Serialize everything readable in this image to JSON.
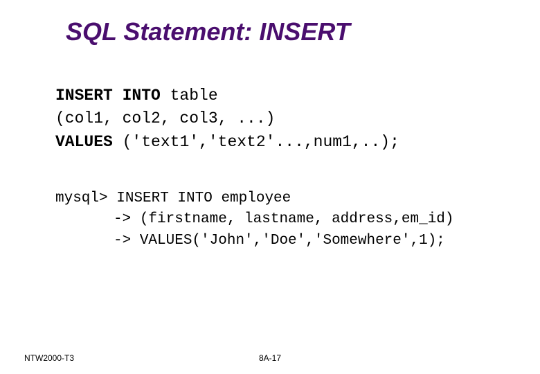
{
  "title": "SQL Statement: INSERT",
  "syntax": {
    "line1_keyword": "INSERT INTO",
    "line1_rest": " table",
    "line2": "(col1, col2, col3, ...)",
    "line3_keyword": "VALUES",
    "line3_rest": " ('text1','text2'...,num1,..);"
  },
  "example": {
    "line1": "mysql> INSERT INTO employee",
    "line2_arrow": "->",
    "line2_rest": " (firstname, lastname, address,em_id)",
    "line3_arrow": "->",
    "line3_rest": " VALUES('John','Doe','Somewhere',1);"
  },
  "footer": {
    "left": "NTW2000-T3",
    "center": "8A-17"
  }
}
